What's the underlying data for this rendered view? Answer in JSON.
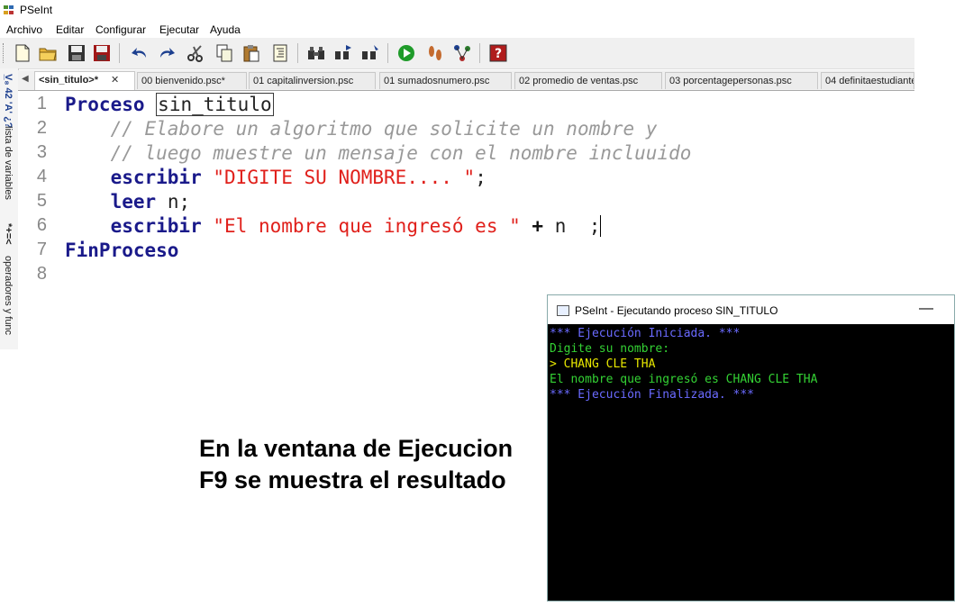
{
  "window": {
    "title": "PSeInt"
  },
  "menu": [
    "Archivo",
    "Editar",
    "Configurar",
    "Ejecutar",
    "Ayuda"
  ],
  "side_panel": {
    "tab1": "lista de variables",
    "tab2": "operadores y func"
  },
  "tabs": [
    {
      "label": "<sin_titulo>*",
      "active": true
    },
    {
      "label": "00 bienvenido.psc*"
    },
    {
      "label": "01 capitalinversion.psc"
    },
    {
      "label": "01 sumadosnumero.psc"
    },
    {
      "label": "02 promedio de ventas.psc"
    },
    {
      "label": "03 porcentagepersonas.psc"
    },
    {
      "label": "04 definitaestudiante"
    }
  ],
  "editor": {
    "line_numbers": [
      "1",
      "2",
      "3",
      "4",
      "5",
      "6",
      "7",
      "8"
    ],
    "l1": {
      "kw": "Proceso",
      "name": "sin_titulo"
    },
    "l2": {
      "comment": "// Elabore un algoritmo que solicite un nombre y"
    },
    "l3": {
      "comment": "// luego muestre un mensaje con el nombre incluuido"
    },
    "l4": {
      "kw": "escribir",
      "str": "\"DIGITE SU NOMBRE.... \"",
      "end": ";"
    },
    "l5": {
      "kw": "leer",
      "rest": "n;"
    },
    "l6": {
      "kw": "escribir",
      "str": "\"El nombre que ingresó es \"",
      "op": "+",
      "id": "n",
      "end": ";"
    },
    "l7": {
      "kw": "FinProceso"
    }
  },
  "caption": {
    "line1": "En la ventana de Ejecucion",
    "line2": "F9 se muestra el resultado"
  },
  "exec_window": {
    "title": "PSeInt - Ejecutando proceso SIN_TITULO",
    "minimize": "—",
    "lines": [
      "*** Ejecución Iniciada. ***",
      "Digite su nombre:",
      "> CHANG CLE THA",
      "El nombre que ingresó es CHANG CLE THA",
      "*** Ejecución Finalizada. ***"
    ]
  },
  "colors": {
    "keyword": "#1a1a8a",
    "string": "#e0201b",
    "comment": "#999999",
    "console_info": "#6a6aff",
    "console_output": "#34d234",
    "console_input": "#e8e800"
  }
}
